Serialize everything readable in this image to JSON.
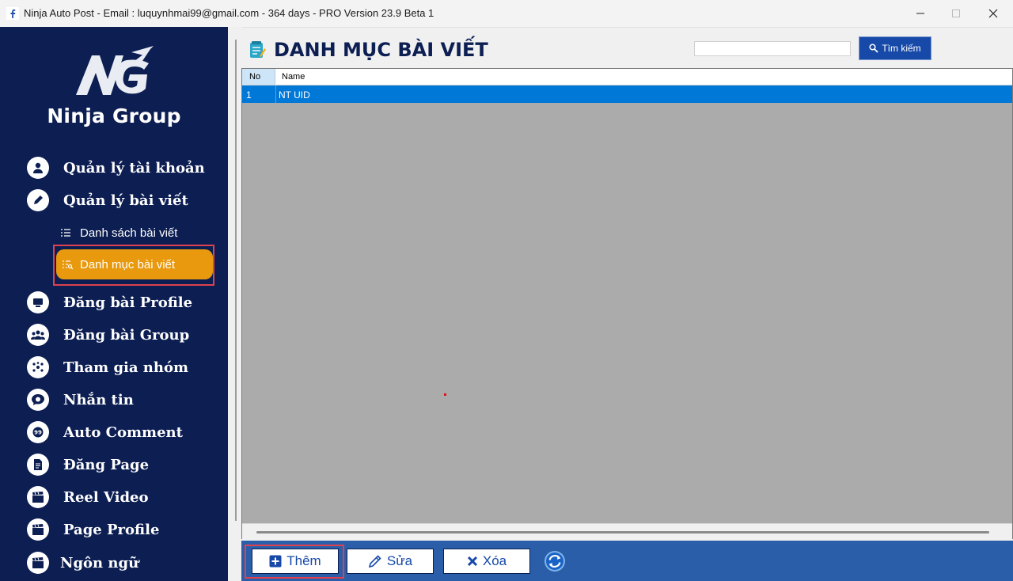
{
  "window": {
    "title": "Ninja Auto Post - Email : luquynhmai99@gmail.com - 364 days -  PRO Version 23.9 Beta 1",
    "app_icon": "facebook-icon",
    "controls": [
      "minimize-icon",
      "maximize-icon",
      "close-icon"
    ]
  },
  "sidebar": {
    "brand": "Ninja Group",
    "logo_text": "NG",
    "items": [
      {
        "label": "Quản lý tài khoản",
        "icon": "user-icon"
      },
      {
        "label": "Quản lý bài viết",
        "icon": "pen-icon"
      },
      {
        "label": "Đăng bài Profile",
        "icon": "monitor-icon"
      },
      {
        "label": "Đăng bài Group",
        "icon": "group-icon"
      },
      {
        "label": "Tham gia nhóm",
        "icon": "network-icon"
      },
      {
        "label": "Nhắn tin",
        "icon": "chat-icon"
      },
      {
        "label": "Auto Comment",
        "icon": "comment-icon"
      },
      {
        "label": "Đăng Page",
        "icon": "document-icon"
      },
      {
        "label": "Reel Video",
        "icon": "clapperboard-icon"
      },
      {
        "label": "Page Profile",
        "icon": "clapperboard-icon"
      },
      {
        "label": "Ngôn ngữ",
        "icon": "clapperboard-icon"
      }
    ],
    "sub_items": [
      {
        "label": "Danh sách bài viết",
        "icon": "list-icon"
      },
      {
        "label": "Danh mục bài viết",
        "icon": "list-search-icon",
        "active": true
      }
    ],
    "active_color": "#e8990d",
    "background": "#0c1e52"
  },
  "main": {
    "title": "DANH MỤC BÀI VIẾT",
    "search": {
      "value": "",
      "placeholder": "",
      "button_label": "Tìm kiếm"
    },
    "table": {
      "columns": [
        "No",
        "Name"
      ],
      "rows": [
        {
          "no": "1",
          "name": "NT UID",
          "selected": true
        }
      ]
    },
    "toolbar": {
      "add_label": "Thêm",
      "edit_label": "Sửa",
      "delete_label": "Xóa",
      "refresh_icon": "refresh-icon"
    },
    "accent": "#1649a8"
  }
}
